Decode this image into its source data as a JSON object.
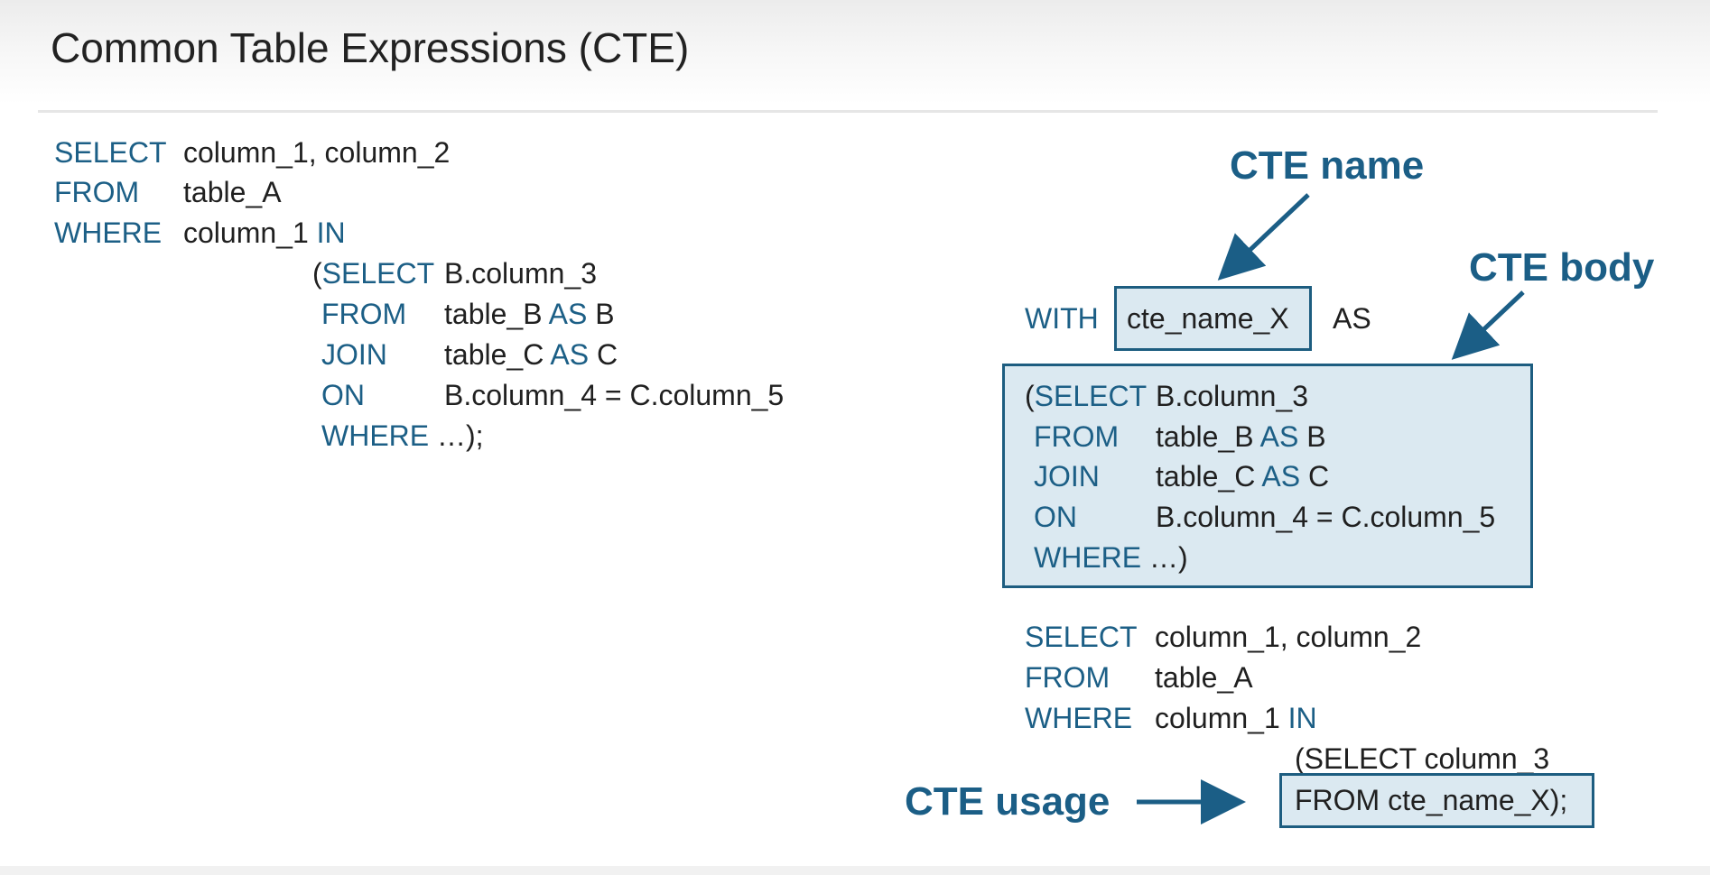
{
  "title": "Common Table Expressions (CTE)",
  "colors": {
    "keyword": "#1c5f86",
    "text": "#202020",
    "highlight_fill": "#dbe9f1",
    "highlight_border": "#1d5d80",
    "annotation": "#1b5e86"
  },
  "left_query": {
    "l1": {
      "kw": "SELECT",
      "tx": "column_1, column_2"
    },
    "l2": {
      "kw": "FROM",
      "tx": "table_A"
    },
    "l3": {
      "kw": "WHERE",
      "tx": "column_1 ",
      "kw2": "IN"
    },
    "sub1": {
      "paren": "(",
      "kw": "SELECT",
      "tx": "B.column_3"
    },
    "sub2": {
      "kw": "FROM",
      "tx": "table_B ",
      "kw2": "AS",
      "tx2": " B"
    },
    "sub3": {
      "kw": "JOIN",
      "tx": "table_C ",
      "kw2": "AS",
      "tx2": " C"
    },
    "sub4": {
      "kw": "ON",
      "tx": "B.column_4 = C.column_5"
    },
    "sub5": {
      "kw": "WHERE",
      "tx": " …);"
    }
  },
  "cte": {
    "with_kw": "WITH",
    "name": "cte_name_X",
    "as_kw": "AS",
    "body": {
      "b1": {
        "paren": "(",
        "kw": "SELECT",
        "tx": "B.column_3"
      },
      "b2": {
        "kw": "FROM",
        "tx": "table_B ",
        "kw2": "AS",
        "tx2": " B"
      },
      "b3": {
        "kw": "JOIN",
        "tx": "table_C ",
        "kw2": "AS",
        "tx2": " C"
      },
      "b4": {
        "kw": "ON",
        "tx": "B.column_4 = C.column_5"
      },
      "b5": {
        "kw": "WHERE",
        "tx": " …)"
      }
    },
    "main": {
      "m1": {
        "kw": "SELECT",
        "tx": "column_1, column_2"
      },
      "m2": {
        "kw": "FROM",
        "tx": "table_A"
      },
      "m3": {
        "kw": "WHERE",
        "tx": "column_1 ",
        "kw2": "IN"
      },
      "m4": "(SELECT column_3",
      "m5": "FROM cte_name_X);"
    }
  },
  "annotations": {
    "cte_name": "CTE name",
    "cte_body": "CTE body",
    "cte_usage": "CTE usage"
  }
}
